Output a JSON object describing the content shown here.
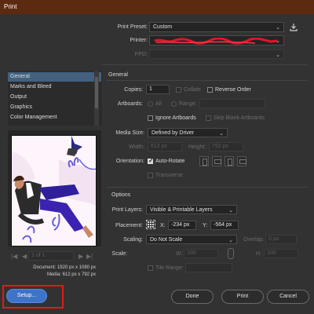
{
  "window": {
    "title": "Print"
  },
  "header": {
    "print_preset_label": "Print Preset:",
    "print_preset_value": "Custom",
    "printer_label": "Printer:",
    "ppd_label": "PPD:"
  },
  "sidebar": {
    "items": [
      {
        "label": "General",
        "selected": true
      },
      {
        "label": "Marks and Bleed",
        "selected": false
      },
      {
        "label": "Output",
        "selected": false
      },
      {
        "label": "Graphics",
        "selected": false
      },
      {
        "label": "Color Management",
        "selected": false
      }
    ]
  },
  "preview": {
    "page_field": "1 of 1",
    "document_info": "Document: 1920 px x 1080 px",
    "media_info": "Media: 612 px x 792 px"
  },
  "general": {
    "section_title": "General",
    "copies_label": "Copies:",
    "copies_value": "1",
    "collate_label": "Collate",
    "reverse_order_label": "Reverse Order",
    "artboards_label": "Artboards:",
    "all_label": "All",
    "range_label": "Range:",
    "ignore_artboards_label": "Ignore Artboards",
    "skip_blank_label": "Skip Blank Artboards",
    "media_size_label": "Media Size:",
    "media_size_value": "Defined by Driver",
    "width_label": "Width:",
    "width_value": "612 px",
    "height_label": "Height:",
    "height_value": "792 px",
    "orientation_label": "Orientation:",
    "auto_rotate_label": "Auto-Rotate",
    "transverse_label": "Transverse"
  },
  "options": {
    "section_title": "Options",
    "print_layers_label": "Print Layers:",
    "print_layers_value": "Visible & Printable Layers",
    "placement_label": "Placement:",
    "x_label": "X:",
    "x_value": "-234 px",
    "y_label": "Y:",
    "y_value": "-564 px",
    "scaling_label": "Scaling:",
    "scaling_value": "Do Not Scale",
    "overlap_label": "Overlap:",
    "overlap_value": "0 px",
    "scale_label": "Scale:",
    "w_label": "W:",
    "w_value": "100",
    "h_label": "H:",
    "h_value": "100",
    "tile_range_label": "Tile Range:"
  },
  "footer": {
    "setup_label": "Setup...",
    "done_label": "Done",
    "print_label": "Print",
    "cancel_label": "Cancel"
  },
  "colors": {
    "title_bar": "#5c2a10",
    "background": "#323232",
    "selection": "#43607f",
    "primary_button": "#3d73c9",
    "highlight_box": "#e21a1a"
  }
}
